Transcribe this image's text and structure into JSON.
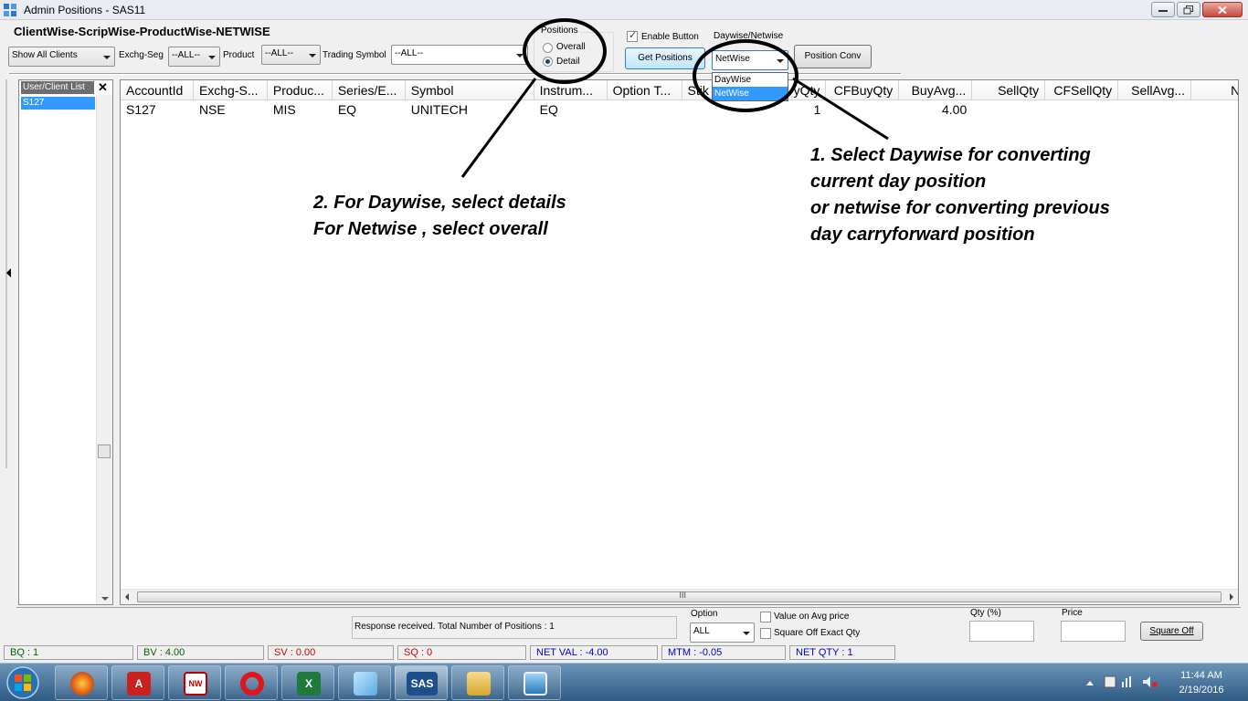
{
  "window": {
    "title": "Admin Positions - SAS11"
  },
  "heading": "ClientWise-ScripWise-ProductWise-NETWISE",
  "filters": {
    "client_select": "Show All Clients",
    "exchseg_label": "Exchg-Seg",
    "exchseg_value": "--ALL--",
    "product_label": "Product",
    "product_value": "--ALL--",
    "symbol_label": "Trading Symbol",
    "symbol_value": "--ALL--"
  },
  "positions_group": {
    "title": "Positions",
    "options": [
      "Overall",
      "Detail"
    ],
    "selected": "Detail"
  },
  "enable_button": {
    "label": "Enable Button",
    "checked": true
  },
  "daywise_netwise": {
    "label": "Daywise/Netwise",
    "value": "NetWise",
    "options": [
      "DayWise",
      "NetWise"
    ],
    "selected_option": "NetWise"
  },
  "buttons": {
    "get_positions": "Get Positions",
    "position_conv": "Position Conv",
    "square_off": "Square Off"
  },
  "client_list": {
    "header": "User/Client List",
    "close_glyph": "✕",
    "items": [
      "S127"
    ]
  },
  "grid": {
    "columns": [
      "AccountId",
      "Exchg-S...",
      "Produc...",
      "Series/E...",
      "Symbol",
      "Instrum...",
      "Option T...",
      "Stik",
      "yQty",
      "CFBuyQty",
      "BuyAvg...",
      "SellQty",
      "CFSellQty",
      "SellAvg...",
      "Ne"
    ],
    "rows": [
      [
        "S127",
        "NSE",
        "MIS",
        "EQ",
        "UNITECH",
        "EQ",
        "",
        "",
        "1",
        "",
        "4.00",
        "",
        "",
        "",
        ""
      ]
    ],
    "scroll_grip": "III"
  },
  "annotations": {
    "note_positions": [
      "2.  For Daywise, select details",
      "For Netwise , select overall"
    ],
    "note_daywise": [
      "1. Select Daywise for converting",
      "current day position",
      "or netwise for converting previous",
      "day carryforward position"
    ]
  },
  "bottom": {
    "response": "Response received. Total Number of Positions : 1",
    "option_label": "Option",
    "option_value": "ALL",
    "value_on_avg": "Value on Avg  price",
    "square_off_exact": "Square Off Exact Qty",
    "qty_label": "Qty (%)",
    "price_label": "Price"
  },
  "status_bar": [
    {
      "text": "BQ : 1",
      "color": "#006400",
      "width": 142
    },
    {
      "text": "BV : 4.00",
      "color": "#006400",
      "width": 139
    },
    {
      "text": "SV : 0.00",
      "color": "#cc0000",
      "width": 138
    },
    {
      "text": "SQ : 0",
      "color": "#cc0000",
      "width": 141
    },
    {
      "text": "NET VAL : -4.00",
      "color": "#0000cc",
      "width": 140
    },
    {
      "text": "MTM : -0.05",
      "color": "#0000cc",
      "width": 136
    },
    {
      "text": "NET QTY : 1",
      "color": "#0000cc",
      "width": 116
    }
  ],
  "taskbar": {
    "apps": [
      "firefox",
      "autocad",
      "app-nwn",
      "opera",
      "excel",
      "notepad",
      "SAS",
      "file-explorer",
      "display"
    ],
    "clock_time": "11:44 AM",
    "clock_date": "2/19/2016"
  },
  "colors": {
    "selection": "#3399ff",
    "annotation_ink": "#000000"
  }
}
